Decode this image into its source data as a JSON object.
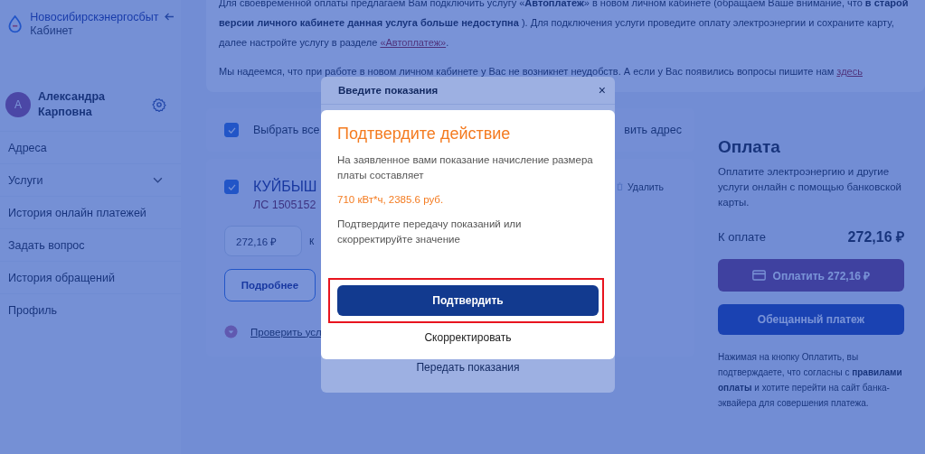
{
  "sidebar": {
    "brand": "Новосибирскэнергосбыт",
    "brand_sub": "Кабинет",
    "user": {
      "initial": "А",
      "name": "Александра Карповна"
    },
    "items": [
      {
        "label": "Адреса",
        "kind": "link"
      },
      {
        "label": "Услуги",
        "kind": "group",
        "expanded": false
      },
      {
        "label": "История онлайн платежей",
        "kind": "link"
      },
      {
        "label": "Задать вопрос",
        "kind": "link"
      },
      {
        "label": "История обращений",
        "kind": "link"
      },
      {
        "label": "Профиль",
        "kind": "link"
      }
    ]
  },
  "notice": {
    "p1_before": "Для своевременной оплаты предлагаем Вам подключить услугу «**Автоплатеж**» в новом личном кабинете (обращаем Ваше внимание, что **в старой версии личного кабинете данная услуга больше недоступна** ). Для подключения услуги проведите оплату электроэнергии и сохраните карту, далее настройте услугу в разделе ",
    "p1_link": "«Автоплатеж»",
    "p1_after": ".",
    "p2_before": "Мы надеемся, что при работе в новом личном кабинете у Вас не возникнет неудобств. А если у Вас появились вопросы пишите нам ",
    "p2_link": "здесь"
  },
  "accounts": {
    "select_all": {
      "label": "Выбрать все",
      "checked": true
    },
    "add_address": "вить адрес",
    "account": {
      "checked": true,
      "address": "КУЙБЫШ",
      "number": "ЛС 1505152",
      "delete": "Удалить",
      "amount": "272,16 ₽",
      "amount_caption": "к",
      "details_button": "Подробнее",
      "check_link": "Проверить усл"
    }
  },
  "payment": {
    "title": "Оплата",
    "description": "Оплатите электроэнергию и другие услуги онлайн с помощью банковской карты.",
    "due_label": "К оплате",
    "due_value": "272,16 ₽",
    "pay_button": {
      "label": "Оплатить 272,16 ₽",
      "disabled": true
    },
    "promised_button": "Обещанный платеж",
    "footnote": "Нажимая на кнопку Оплатить, вы подтверждаете, что согласны с **правилами оплаты** и хотите перейти на сайт банка-эквайера для совершения платежа."
  },
  "readings_modal": {
    "title": "Введите показания",
    "close": "×",
    "submit": "Передать показания"
  },
  "confirm_dialog": {
    "title": "Подтвердите действие",
    "text": "На заявленное вами показание начисление размера платы составляет",
    "amount": "710 кВт*ч, 2385.6 руб.",
    "question": "Подтвердите передачу показаний или скорректируйте значение",
    "confirm_button": {
      "label": "Подтвердить",
      "highlighted": true
    },
    "correct_button": "Скорректировать"
  }
}
